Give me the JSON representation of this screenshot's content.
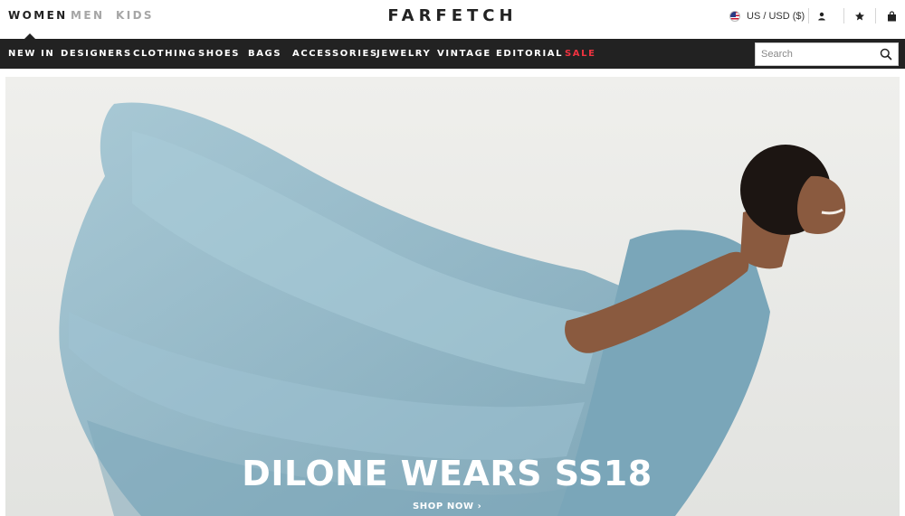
{
  "header": {
    "genders": [
      {
        "label": "WOMEN",
        "active": true
      },
      {
        "label": "MEN",
        "active": false
      },
      {
        "label": "KIDS",
        "active": false
      }
    ],
    "logo": "FARFETCH",
    "locale": "US / USD ($)",
    "icons": [
      "user-icon",
      "star-icon",
      "bag-icon"
    ]
  },
  "nav": {
    "items": [
      "NEW IN",
      "DESIGNERS",
      "CLOTHING",
      "SHOES",
      "BAGS",
      "ACCESSORIES",
      "JEWELRY",
      "VINTAGE",
      "EDITORIAL",
      "SALE"
    ],
    "sale_color": "#ef3340"
  },
  "search": {
    "placeholder": "Search",
    "value": ""
  },
  "hero": {
    "title": "DILONE WEARS SS18",
    "cta": "SHOP NOW ›"
  },
  "colors": {
    "navbar_bg": "#222222",
    "hero_bg": "#ecece9",
    "dress": "#8ab3c4"
  }
}
